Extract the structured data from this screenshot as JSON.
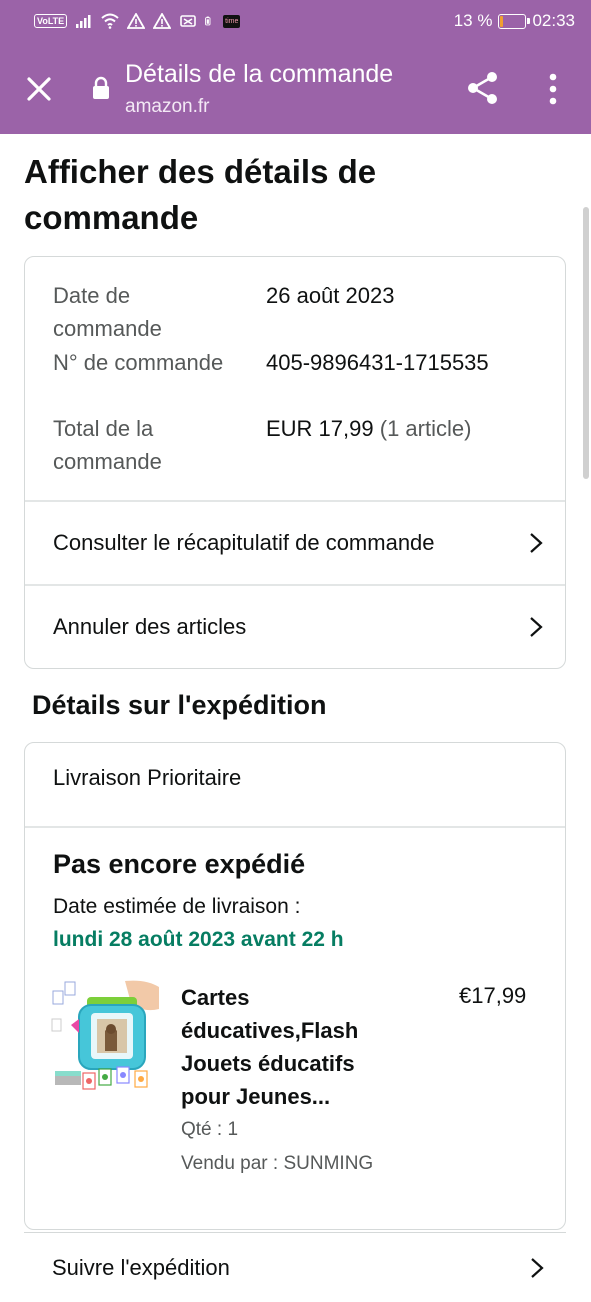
{
  "status_bar": {
    "volte": "VoLTE",
    "time_app_badge": "time",
    "battery_percent": "13 %",
    "battery_level": 0.13,
    "clock": "02:33",
    "icons": [
      "signal-icon",
      "wifi-icon",
      "warning-icon",
      "warning-icon",
      "no-sim-icon",
      "battery-saver-icon",
      "time-app-icon"
    ]
  },
  "header": {
    "title": "Détails de la commande",
    "domain": "amazon.fr",
    "icons": [
      "close-icon",
      "lock-icon",
      "share-icon",
      "more-vert-icon"
    ],
    "background": "#9b63a8"
  },
  "page": {
    "title": "Afficher des détails de commande"
  },
  "order_summary": {
    "date_label": "Date de commande",
    "date_value": "26 août 2023",
    "number_label": "N° de commande",
    "number_value": "405-9896431-1715535",
    "total_label": "Total de la commande",
    "total_value": "EUR 17,99",
    "total_items": "(1 article)",
    "link_summary": "Consulter le récapitulatif de commande",
    "link_cancel": "Annuler des articles"
  },
  "shipment": {
    "section_title": "Détails sur l'expédition",
    "shipping_type": "Livraison Prioritaire",
    "status": "Pas encore expédié",
    "estimate_label": "Date estimée de livraison :",
    "estimate_date": "lundi 28 août 2023 avant 22 h",
    "estimate_color": "#067d62",
    "product": {
      "name": "Cartes éducatives,Flash Jouets éducatifs pour Jeunes...",
      "price": "€17,99",
      "quantity": "Qté : 1",
      "seller": "Vendu par : SUNMING"
    },
    "track_link": "Suivre l'expédition"
  }
}
